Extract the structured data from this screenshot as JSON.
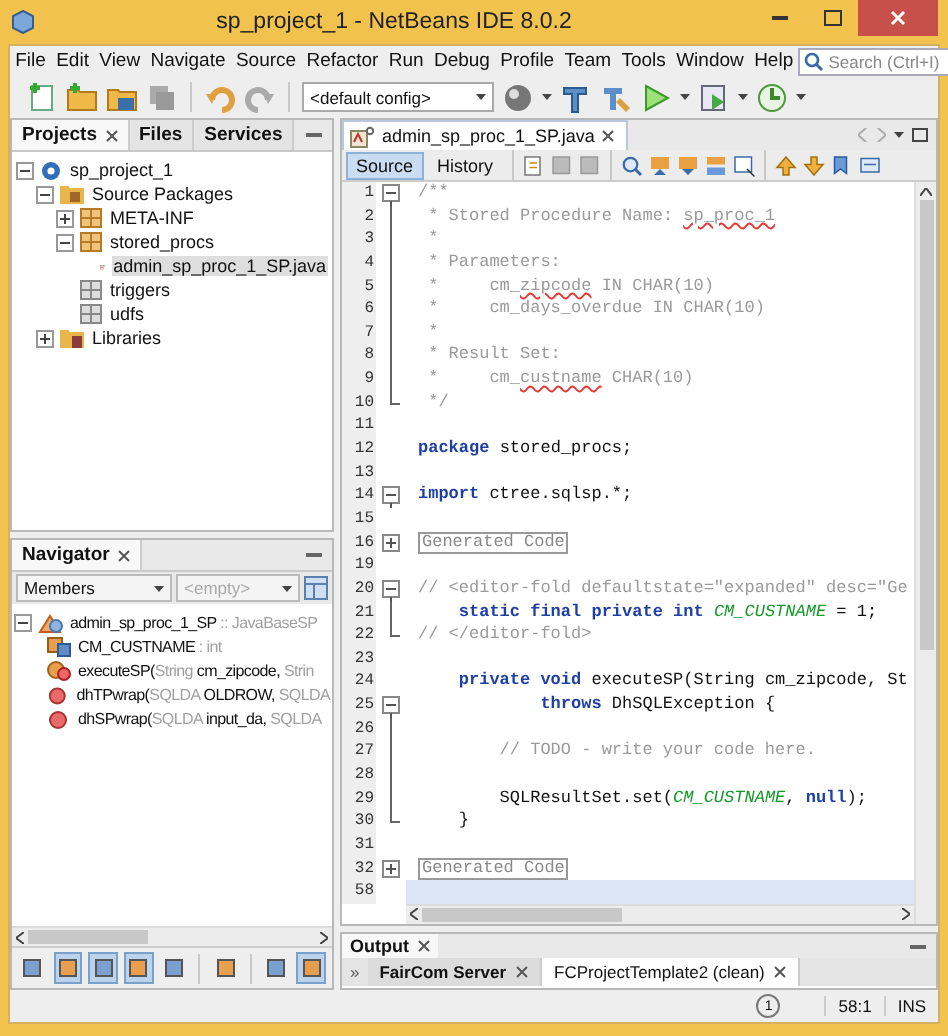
{
  "window": {
    "title": "sp_project_1 - NetBeans IDE 8.0.2"
  },
  "menu": [
    "File",
    "Edit",
    "View",
    "Navigate",
    "Source",
    "Refactor",
    "Run",
    "Debug",
    "Profile",
    "Team",
    "Tools",
    "Window",
    "Help"
  ],
  "search": {
    "placeholder": "Search (Ctrl+I)"
  },
  "toolbar": {
    "config": "<default config>"
  },
  "projects": {
    "tabs": [
      {
        "label": "Projects",
        "selected": true
      },
      {
        "label": "Files",
        "selected": false
      },
      {
        "label": "Services",
        "selected": false
      }
    ],
    "tree": [
      {
        "label": "sp_project_1",
        "kind": "project",
        "expanded": true,
        "selected": false,
        "children": [
          {
            "label": "Source Packages",
            "kind": "source-folder",
            "expanded": true,
            "selected": false,
            "children": [
              {
                "label": "META-INF",
                "kind": "package",
                "expanded": false,
                "selected": false
              },
              {
                "label": "stored_procs",
                "kind": "package",
                "expanded": true,
                "selected": false,
                "children": [
                  {
                    "label": "admin_sp_proc_1_SP.java",
                    "kind": "java",
                    "selected": true
                  }
                ]
              },
              {
                "label": "triggers",
                "kind": "empty-package",
                "selected": false
              },
              {
                "label": "udfs",
                "kind": "empty-package",
                "selected": false
              }
            ]
          },
          {
            "label": "Libraries",
            "kind": "library",
            "expanded": false,
            "selected": false
          }
        ]
      }
    ]
  },
  "navigator": {
    "title": "Navigator",
    "filter": "Members",
    "scope": "<empty>",
    "members": [
      {
        "kind": "class",
        "expanded": true,
        "segments": [
          {
            "text": "admin_sp_proc_1_SP",
            "muted": false
          },
          {
            "text": " :: JavaBaseSP",
            "muted": true
          }
        ],
        "children": [
          {
            "kind": "field",
            "segments": [
              {
                "text": "CM_CUSTNAME",
                "muted": false
              },
              {
                "text": " : int",
                "muted": true
              }
            ]
          },
          {
            "kind": "method",
            "segments": [
              {
                "text": "executeSP(",
                "muted": false
              },
              {
                "text": "String",
                "muted": true
              },
              {
                "text": " cm_zipcode, ",
                "muted": false
              },
              {
                "text": "Strin",
                "muted": true
              }
            ]
          },
          {
            "kind": "private-method",
            "segments": [
              {
                "text": "dhTPwrap(",
                "muted": false
              },
              {
                "text": "SQLDA",
                "muted": true
              },
              {
                "text": " OLDROW, ",
                "muted": false
              },
              {
                "text": "SQLDA",
                "muted": true
              }
            ]
          },
          {
            "kind": "private-method",
            "segments": [
              {
                "text": "dhSPwrap(",
                "muted": false
              },
              {
                "text": "SQLDA",
                "muted": true
              },
              {
                "text": " input_da, ",
                "muted": false
              },
              {
                "text": "SQLDA",
                "muted": true
              }
            ]
          }
        ]
      }
    ],
    "filters": [
      {
        "on": false
      },
      {
        "on": true
      },
      {
        "on": true
      },
      {
        "on": true
      },
      {
        "on": false
      },
      {
        "on": false
      },
      {
        "on": false
      },
      {
        "on": true
      }
    ]
  },
  "editor": {
    "tab": "admin_sp_proc_1_SP.java",
    "views": [
      {
        "label": "Source",
        "selected": true
      },
      {
        "label": "History",
        "selected": false
      }
    ],
    "lines": [
      {
        "number": "1",
        "kind": "fold-start",
        "current": false,
        "segments": [
          {
            "text": "/**",
            "kind": "comment"
          }
        ]
      },
      {
        "number": "2",
        "kind": "fold-inside",
        "current": false,
        "segments": [
          {
            "text": " * Stored Procedure Name: ",
            "kind": "comment"
          },
          {
            "text": "sp_proc_1",
            "kind": "misspelled"
          }
        ]
      },
      {
        "number": "3",
        "kind": "fold-inside",
        "current": false,
        "segments": [
          {
            "text": " *",
            "kind": "comment"
          }
        ]
      },
      {
        "number": "4",
        "kind": "fold-inside",
        "current": false,
        "segments": [
          {
            "text": " * Parameters:",
            "kind": "comment"
          }
        ]
      },
      {
        "number": "5",
        "kind": "fold-inside",
        "current": false,
        "segments": [
          {
            "text": " *     cm_",
            "kind": "comment"
          },
          {
            "text": "zipcode",
            "kind": "misspelled"
          },
          {
            "text": " IN CHAR(10)",
            "kind": "comment"
          }
        ]
      },
      {
        "number": "6",
        "kind": "fold-inside",
        "current": false,
        "segments": [
          {
            "text": " *     cm_days_overdue IN CHAR(10)",
            "kind": "comment"
          }
        ]
      },
      {
        "number": "7",
        "kind": "fold-inside",
        "current": false,
        "segments": [
          {
            "text": " *",
            "kind": "comment"
          }
        ]
      },
      {
        "number": "8",
        "kind": "fold-inside",
        "current": false,
        "segments": [
          {
            "text": " * Result Set:",
            "kind": "comment"
          }
        ]
      },
      {
        "number": "9",
        "kind": "fold-inside",
        "current": false,
        "segments": [
          {
            "text": " *     cm_",
            "kind": "comment"
          },
          {
            "text": "custname",
            "kind": "misspelled"
          },
          {
            "text": " CHAR(10)",
            "kind": "comment"
          }
        ]
      },
      {
        "number": "10",
        "kind": "fold-end",
        "current": false,
        "segments": [
          {
            "text": " */",
            "kind": "comment"
          }
        ]
      },
      {
        "number": "11",
        "current": false
      },
      {
        "number": "12",
        "current": false,
        "segments": [
          {
            "text": "package",
            "kind": "keyword"
          },
          {
            "text": " stored_procs;",
            "kind": "plain"
          }
        ]
      },
      {
        "number": "13",
        "current": false
      },
      {
        "number": "14",
        "kind": "fold-start",
        "current": false,
        "segments": [
          {
            "text": "import",
            "kind": "keyword"
          },
          {
            "text": " ctree.sqlsp.*;",
            "kind": "plain"
          }
        ]
      },
      {
        "number": "15",
        "current": false
      },
      {
        "number": "16",
        "kind": "folded",
        "current": false,
        "segments": [
          {
            "text": "Generated Code",
            "kind": "fold-label"
          }
        ]
      },
      {
        "number": "19",
        "current": false
      },
      {
        "number": "20",
        "kind": "fold-start",
        "current": false,
        "segments": [
          {
            "text": "// <editor-fold defaultstate=\"expanded\" desc=\"Ge",
            "kind": "comment"
          }
        ]
      },
      {
        "number": "21",
        "kind": "fold-inside",
        "current": false,
        "segments": [
          {
            "text": "    static final private int ",
            "kind": "keyword"
          },
          {
            "text": "CM_CUSTNAME",
            "kind": "field"
          },
          {
            "text": " = 1;",
            "kind": "plain"
          }
        ]
      },
      {
        "number": "22",
        "kind": "fold-end",
        "current": false,
        "segments": [
          {
            "text": "// </editor-fold>",
            "kind": "comment"
          }
        ]
      },
      {
        "number": "23",
        "current": false
      },
      {
        "number": "24",
        "current": false,
        "segments": [
          {
            "text": "    private void",
            "kind": "keyword"
          },
          {
            "text": " executeSP(String cm_zipcode, St",
            "kind": "plain"
          }
        ]
      },
      {
        "number": "25",
        "kind": "fold-start",
        "current": false,
        "segments": [
          {
            "text": "            throws",
            "kind": "keyword"
          },
          {
            "text": " DhSQLException {",
            "kind": "plain"
          }
        ]
      },
      {
        "number": "26",
        "kind": "fold-inside",
        "current": false
      },
      {
        "number": "27",
        "kind": "fold-inside",
        "current": false,
        "segments": [
          {
            "text": "        // TODO - write your code here.",
            "kind": "comment"
          }
        ]
      },
      {
        "number": "28",
        "kind": "fold-inside",
        "current": false
      },
      {
        "number": "29",
        "kind": "fold-inside",
        "current": false,
        "segments": [
          {
            "text": "        SQLResultSet.set(",
            "kind": "plain"
          },
          {
            "text": "CM_CUSTNAME",
            "kind": "field"
          },
          {
            "text": ", ",
            "kind": "plain"
          },
          {
            "text": "null",
            "kind": "keyword"
          },
          {
            "text": ");",
            "kind": "plain"
          }
        ]
      },
      {
        "number": "30",
        "kind": "fold-end",
        "current": false,
        "segments": [
          {
            "text": "    }",
            "kind": "plain"
          }
        ]
      },
      {
        "number": "31",
        "current": false
      },
      {
        "number": "32",
        "kind": "folded",
        "current": false,
        "segments": [
          {
            "text": "Generated Code",
            "kind": "fold-label"
          }
        ]
      },
      {
        "number": "58",
        "current": true
      }
    ]
  },
  "output": {
    "title": "Output",
    "overflow": "»",
    "tabs": [
      {
        "label": "FairCom Server",
        "highlighted": true,
        "selected": false
      },
      {
        "label": "FCProjectTemplate2 (clean)",
        "highlighted": false,
        "selected": true
      }
    ]
  },
  "status": {
    "notifications": "1",
    "position": "58:1",
    "mode": "INS"
  }
}
